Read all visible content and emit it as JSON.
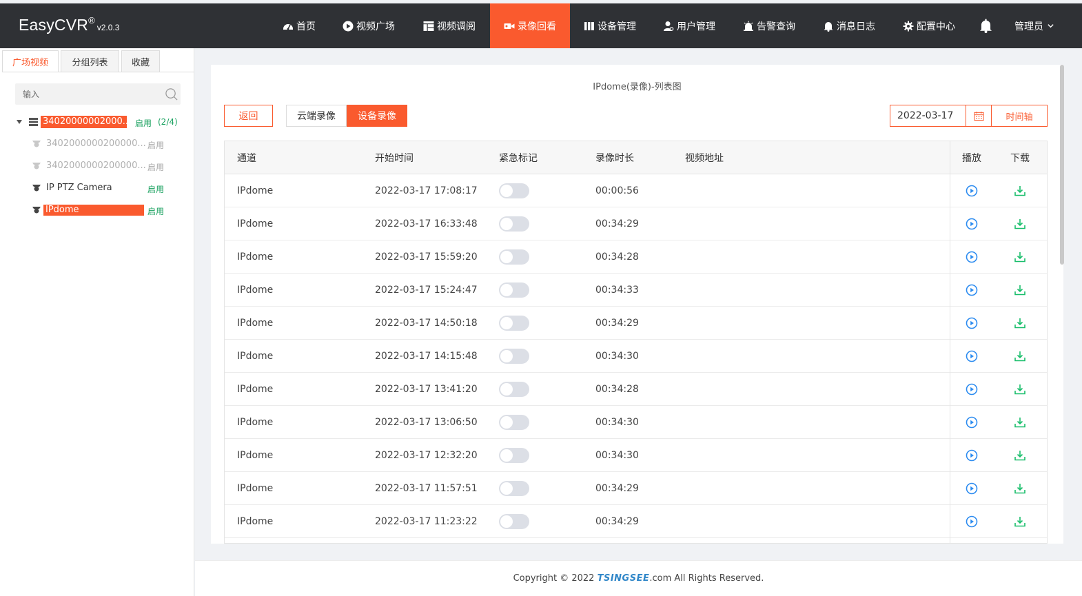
{
  "app": {
    "name": "EasyCVR",
    "reg": "®",
    "version": "v2.0.3"
  },
  "nav": [
    {
      "label": "首页",
      "icon": "dashboard-icon"
    },
    {
      "label": "视频广场",
      "icon": "play-circle-icon"
    },
    {
      "label": "视频调阅",
      "icon": "grid-icon"
    },
    {
      "label": "录像回看",
      "icon": "video-camera-icon",
      "active": true
    },
    {
      "label": "设备管理",
      "icon": "server-icon"
    },
    {
      "label": "用户管理",
      "icon": "user-icon"
    },
    {
      "label": "告警查询",
      "icon": "alarm-icon"
    },
    {
      "label": "消息日志",
      "icon": "bell-icon"
    },
    {
      "label": "配置中心",
      "icon": "gear-icon"
    }
  ],
  "user": {
    "label": "管理员"
  },
  "sidebar": {
    "tabs": [
      "广场视频",
      "分组列表",
      "收藏"
    ],
    "search_placeholder": "输入",
    "tree": {
      "root": {
        "label": "34020000002000...",
        "status": "启用",
        "count": "(2/4)"
      },
      "children": [
        {
          "label": "3402000000200000...",
          "status": "启用",
          "state": "disabled"
        },
        {
          "label": "3402000000200000...",
          "status": "启用",
          "state": "disabled"
        },
        {
          "label": "IP PTZ Camera",
          "status": "启用",
          "state": "normal"
        },
        {
          "label": "IPdome",
          "status": "启用",
          "state": "selected"
        }
      ]
    }
  },
  "main": {
    "title": "IPdome(录像)-列表图",
    "back_label": "返回",
    "seg_cloud": "云端录像",
    "seg_device": "设备录像",
    "date": "2022-03-17",
    "timeline_label": "时间轴",
    "columns": {
      "channel": "通道",
      "start": "开始时间",
      "urgent": "紧急标记",
      "duration": "录像时长",
      "url": "视频地址",
      "play": "播放",
      "download": "下载"
    },
    "rows": [
      {
        "channel": "IPdome",
        "start": "2022-03-17 17:08:17",
        "duration": "00:00:56"
      },
      {
        "channel": "IPdome",
        "start": "2022-03-17 16:33:48",
        "duration": "00:34:29"
      },
      {
        "channel": "IPdome",
        "start": "2022-03-17 15:59:20",
        "duration": "00:34:28"
      },
      {
        "channel": "IPdome",
        "start": "2022-03-17 15:24:47",
        "duration": "00:34:33"
      },
      {
        "channel": "IPdome",
        "start": "2022-03-17 14:50:18",
        "duration": "00:34:29"
      },
      {
        "channel": "IPdome",
        "start": "2022-03-17 14:15:48",
        "duration": "00:34:30"
      },
      {
        "channel": "IPdome",
        "start": "2022-03-17 13:41:20",
        "duration": "00:34:28"
      },
      {
        "channel": "IPdome",
        "start": "2022-03-17 13:06:50",
        "duration": "00:34:30"
      },
      {
        "channel": "IPdome",
        "start": "2022-03-17 12:32:20",
        "duration": "00:34:30"
      },
      {
        "channel": "IPdome",
        "start": "2022-03-17 11:57:51",
        "duration": "00:34:29"
      },
      {
        "channel": "IPdome",
        "start": "2022-03-17 11:23:22",
        "duration": "00:34:29"
      }
    ]
  },
  "footer": {
    "prefix": "Copyright © 2022 ",
    "brand": "TSINGSEE",
    "suffix": ".com All Rights Reserved."
  },
  "colors": {
    "accent": "#fa5a2e",
    "navbar": "#2f3135",
    "status_green": "#19a15f",
    "play_blue": "#2d8cf0",
    "download_green": "#19be6b"
  }
}
